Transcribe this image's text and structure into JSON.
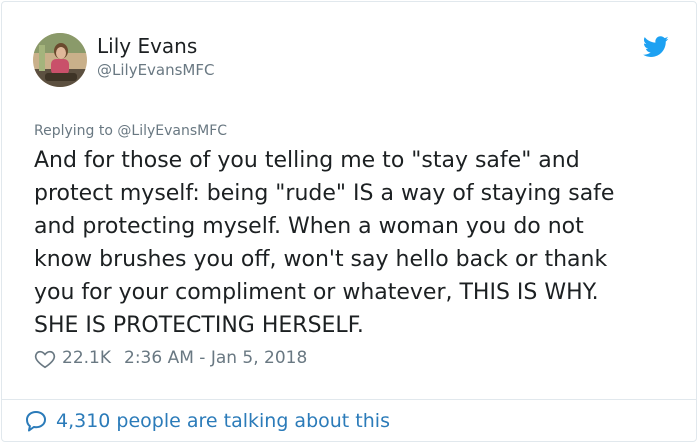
{
  "tweet": {
    "author_name": "Lily Evans",
    "author_handle": "@LilyEvansMFC",
    "replying_prefix": "Replying to ",
    "replying_handle": "@LilyEvansMFC",
    "text": "And for those of you telling me to \"stay safe\" and\nprotect myself: being \"rude\" IS a way of staying safe\nand protecting myself. When a woman you do not\nknow brushes you off, won't say hello back or thank\nyou for your compliment or whatever, THIS IS WHY.\nSHE IS PROTECTING HERSELF.",
    "likes": "22.1K",
    "timestamp": "2:36 AM - Jan 5, 2018",
    "talking": "4,310 people are talking about this"
  },
  "icons": {
    "brand": "twitter-bird-icon",
    "like": "heart-icon",
    "conversation": "speech-bubble-icon"
  },
  "colors": {
    "twitter_blue": "#1da1f2",
    "link_blue": "#2b7bb9",
    "muted": "#697882",
    "text": "#1c2022"
  }
}
